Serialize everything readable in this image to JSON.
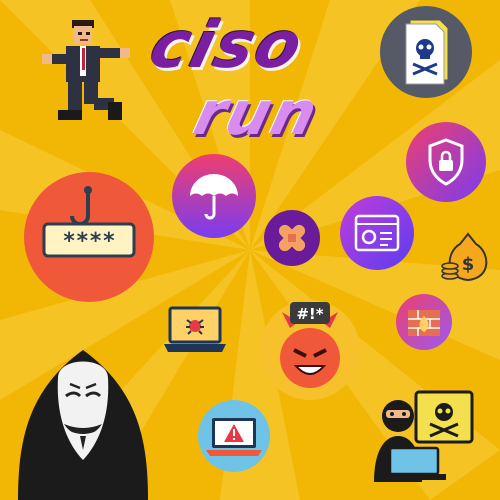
{
  "game": {
    "title_line_1": "ciso",
    "title_line_2": "run"
  },
  "colors": {
    "background": "#f2b705",
    "ray": "#f7c62b",
    "title_purple": "#7a1fa2",
    "title_lilac": "#d88cf0",
    "coral": "#f0583a",
    "pink": "#ef3e6e",
    "violet": "#7a3df0",
    "gold": "#f6a81c"
  },
  "elements": [
    {
      "name": "running-businessman-sprite",
      "icon": "pixel-runner"
    },
    {
      "name": "toxic-document-icon",
      "icon": "skull-document"
    },
    {
      "name": "phishing-password-icon",
      "icon": "hook-password"
    },
    {
      "name": "umbrella-protection-icon",
      "icon": "umbrella"
    },
    {
      "name": "security-shield-icon",
      "icon": "shield-lock"
    },
    {
      "name": "patch-bandage-icon",
      "icon": "bandage"
    },
    {
      "name": "web-settings-icon",
      "icon": "browser-gear"
    },
    {
      "name": "money-bag-icon",
      "icon": "money-bag"
    },
    {
      "name": "malware-laptop-icon",
      "icon": "bug-laptop"
    },
    {
      "name": "angry-devil-icon",
      "icon": "devil-face"
    },
    {
      "name": "firewall-icon",
      "icon": "fire-wall"
    },
    {
      "name": "anonymous-hacker-icon",
      "icon": "guy-fawkes-mask"
    },
    {
      "name": "alert-laptop-icon",
      "icon": "warning-laptop"
    },
    {
      "name": "ransomware-hacker-icon",
      "icon": "masked-hacker"
    }
  ],
  "devil_bubble": "#!*",
  "password_mask": "****"
}
